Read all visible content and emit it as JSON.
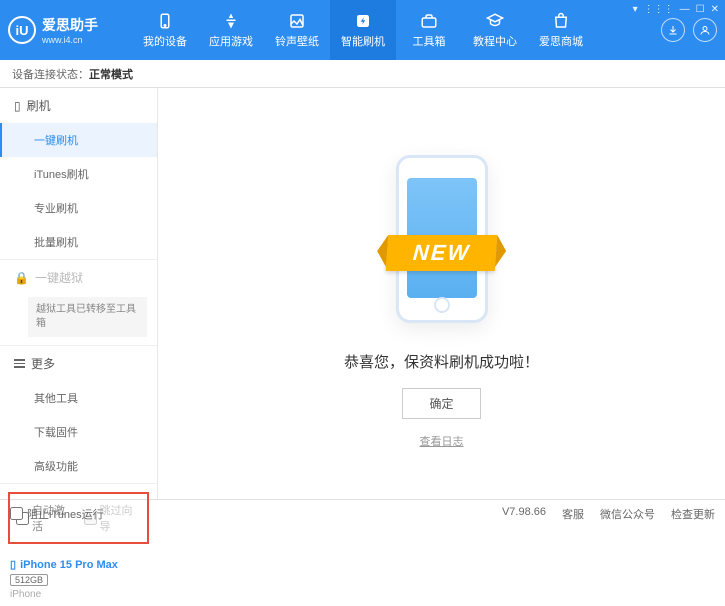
{
  "app": {
    "title": "爱思助手",
    "subtitle": "www.i4.cn"
  },
  "windowControls": {
    "menu": "▾",
    "grid": "⋮⋮⋮",
    "min": "—",
    "max": "☐",
    "close": "✕"
  },
  "nav": [
    {
      "label": "我的设备"
    },
    {
      "label": "应用游戏"
    },
    {
      "label": "铃声壁纸"
    },
    {
      "label": "智能刷机",
      "active": true
    },
    {
      "label": "工具箱"
    },
    {
      "label": "教程中心"
    },
    {
      "label": "爱思商城"
    }
  ],
  "status": {
    "prefix": "设备连接状态：",
    "value": "正常模式"
  },
  "sidebar": {
    "flash": {
      "head": "刷机",
      "items": [
        "一键刷机",
        "iTunes刷机",
        "专业刷机",
        "批量刷机"
      ]
    },
    "jailbreak": {
      "head": "一键越狱",
      "note": "越狱工具已转移至工具箱"
    },
    "more": {
      "head": "更多",
      "items": [
        "其他工具",
        "下载固件",
        "高级功能"
      ]
    },
    "checks": {
      "auto": "自动激活",
      "skip": "跳过向导"
    },
    "device": {
      "name": "iPhone 15 Pro Max",
      "storage": "512GB",
      "type": "iPhone"
    }
  },
  "main": {
    "ribbon": "NEW",
    "success": "恭喜您，保资料刷机成功啦！",
    "ok": "确定",
    "log": "查看日志"
  },
  "footer": {
    "block": "阻止iTunes运行",
    "version": "V7.98.66",
    "links": [
      "客服",
      "微信公众号",
      "检查更新"
    ]
  }
}
